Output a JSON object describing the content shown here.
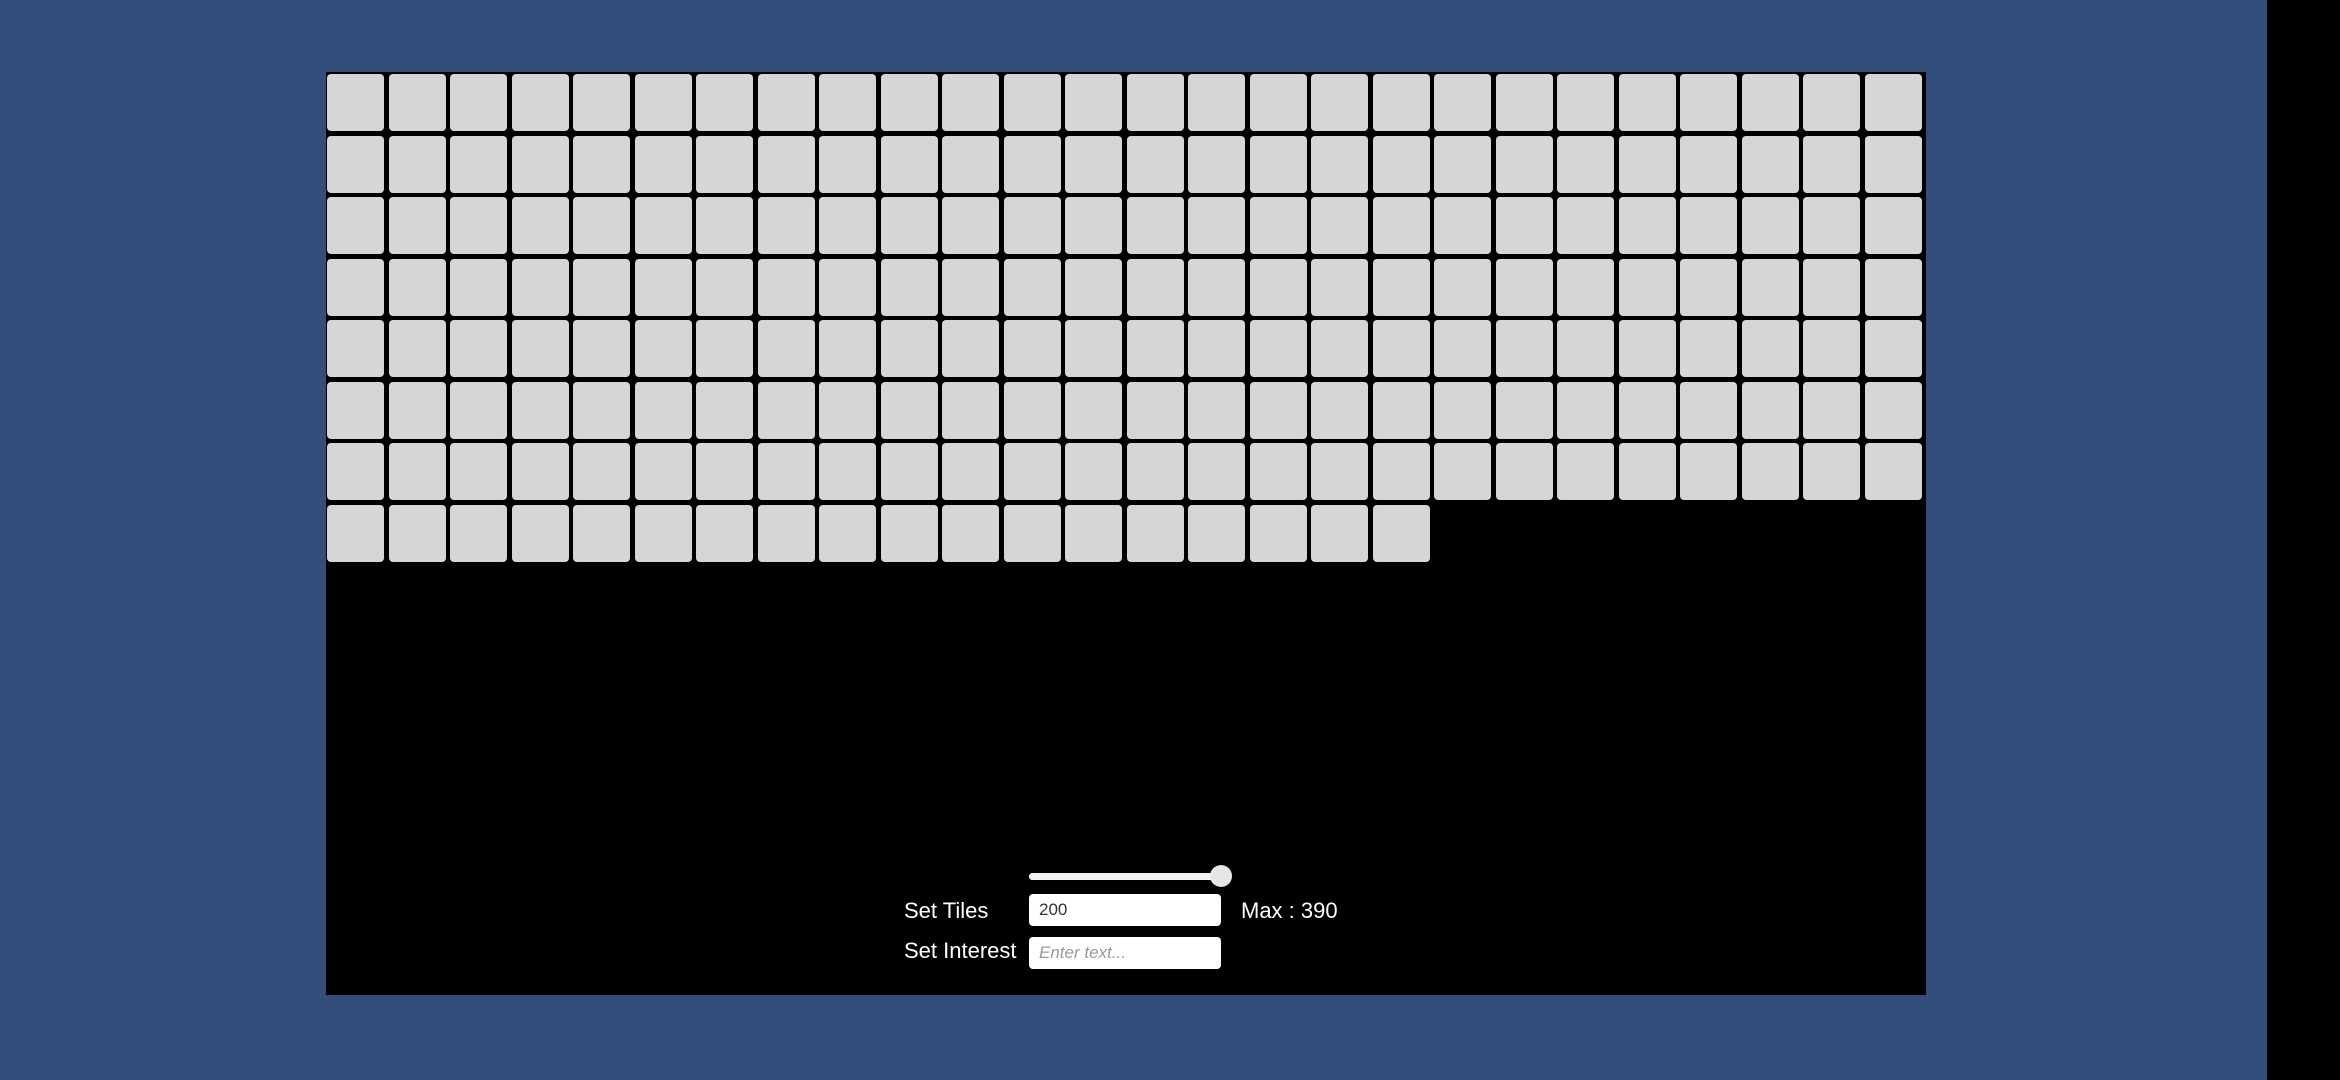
{
  "colors": {
    "background": "#314f7a",
    "panel": "#000000",
    "tile": "#d6d6d6"
  },
  "grid": {
    "tile_count": 200,
    "columns": 26
  },
  "slider": {
    "value_fraction": 1.0
  },
  "controls": {
    "tiles_label": "Set Tiles",
    "tiles_value": "200",
    "max_text": "Max : 390",
    "interest_label": "Set Interest",
    "interest_value": "",
    "interest_placeholder": "Enter text..."
  }
}
